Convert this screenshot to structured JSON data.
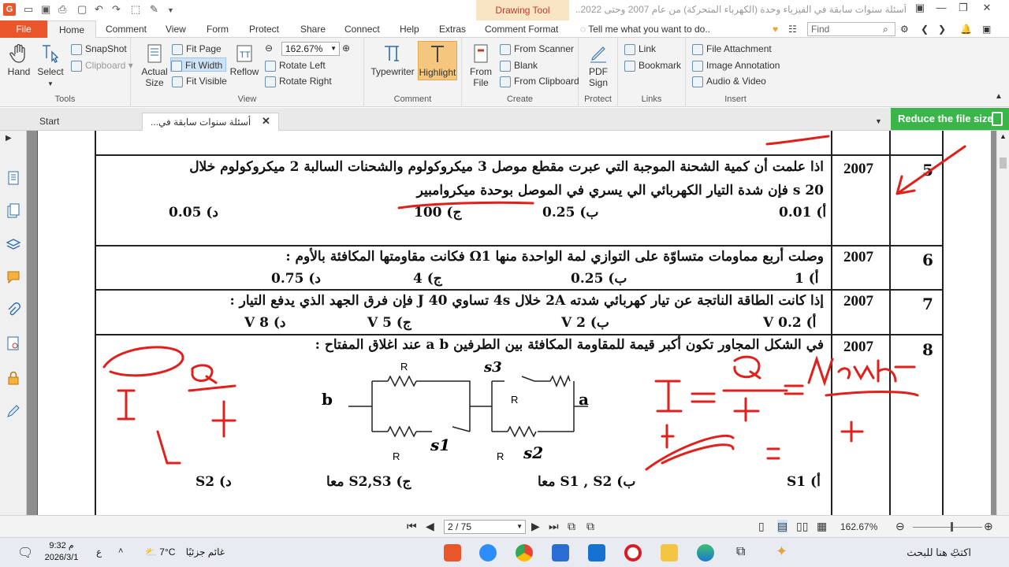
{
  "titlebar": {
    "context_tab": "Drawing Tool",
    "window_title": "أسئلة سنوات سابقة في الفيزياء وحدة (الكهرباء المتحركة) من عام 2007 وحتى 2022..."
  },
  "ribbon_tabs": {
    "file": "File",
    "home": "Home",
    "comment": "Comment",
    "view": "View",
    "form": "Form",
    "protect": "Protect",
    "share": "Share",
    "connect": "Connect",
    "help": "Help",
    "extras": "Extras",
    "comment_format": "Comment Format",
    "tell_me": "Tell me what you want to do..",
    "find_placeholder": "Find"
  },
  "ribbon": {
    "tools": {
      "hand": "Hand",
      "select": "Select",
      "snapshot": "SnapShot",
      "clipboard": "Clipboard",
      "label": "Tools"
    },
    "view": {
      "actual_size_1": "Actual",
      "actual_size_2": "Size",
      "fit_page": "Fit Page",
      "fit_width": "Fit Width",
      "fit_visible": "Fit Visible",
      "reflow": "Reflow",
      "zoom_value": "162.67%",
      "rotate_left": "Rotate Left",
      "rotate_right": "Rotate Right",
      "label": "View"
    },
    "comment": {
      "typewriter": "Typewriter",
      "highlight": "Highlight",
      "label": "Comment"
    },
    "create": {
      "from_file_1": "From",
      "from_file_2": "File",
      "from_scanner": "From Scanner",
      "blank": "Blank",
      "from_clipboard": "From Clipboard",
      "label": "Create"
    },
    "protect": {
      "pdf_sign_1": "PDF",
      "pdf_sign_2": "Sign",
      "label": "Protect"
    },
    "links": {
      "link": "Link",
      "bookmark": "Bookmark",
      "label": "Links"
    },
    "insert": {
      "file_attachment": "File Attachment",
      "image_annotation": "Image Annotation",
      "audio_video": "Audio & Video",
      "label": "Insert"
    }
  },
  "doc_tabs": {
    "start": "Start",
    "current": "أسئلة سنوات سابقة في...",
    "reduce": "Reduce the file size"
  },
  "questions": [
    {
      "num": "5",
      "year": "2007",
      "line1": "اذا علمت أن كمية الشحنة الموجبة التي عبرت مقطع موصل 3 ميكروكولوم  والشحنات السالبة 2 ميكروكولوم خلال",
      "line2": "20 s فإن شدة التيار الكهربائي الي يسري في الموصل بوحدة ميكروامبير",
      "options": [
        "أ) 0.01",
        "ب) 0.25",
        "ج) 100",
        "د) 0.05"
      ]
    },
    {
      "num": "6",
      "year": "2007",
      "line1": "وصلت أربع مماومات متساوّة على التوازي لمة الواحدة منها Ω1 فكانت مقاومتها المكافئة بالأوم  :",
      "options": [
        "أ)  1",
        "ب)  0.25",
        "ج)  4",
        "د)  0.75"
      ]
    },
    {
      "num": "7",
      "year": "2007",
      "line1": "إذا كانت الطاقة الناتجة عن تيار كهربائي شدته 2A خلال 4s تساوي 40 J فإن فرق الجهد الذي يدفع التيار :",
      "options": [
        "أ)  0.2 V",
        "ب)  2 V",
        "ج)  5  V",
        "د)  8 V"
      ]
    },
    {
      "num": "8",
      "year": "2007",
      "line1": "في الشكل المجاور تكون أكبر قيمة للمقاومة المكافئة بين الطرفين  a b  عند اغلاق  المفتاح :",
      "options": [
        "أ)  S1",
        "ب)  S1 , S2  معا",
        "ج)  S2,S3 معا",
        "د)  S2"
      ]
    }
  ],
  "circuit": {
    "terminal_b": "b",
    "terminal_a": "a",
    "r": "R",
    "s1": "s1",
    "s2": "s2",
    "s3": "s3"
  },
  "statusbar": {
    "page_value": "2 / 75",
    "zoom": "162.67%"
  },
  "taskbar": {
    "search": "اكتب هنا للبحث",
    "weather_temp": "7°C",
    "weather_text": "غائم جزئيًا",
    "time": "9:32 م",
    "date": "2026/3/1",
    "lang": "ع"
  }
}
